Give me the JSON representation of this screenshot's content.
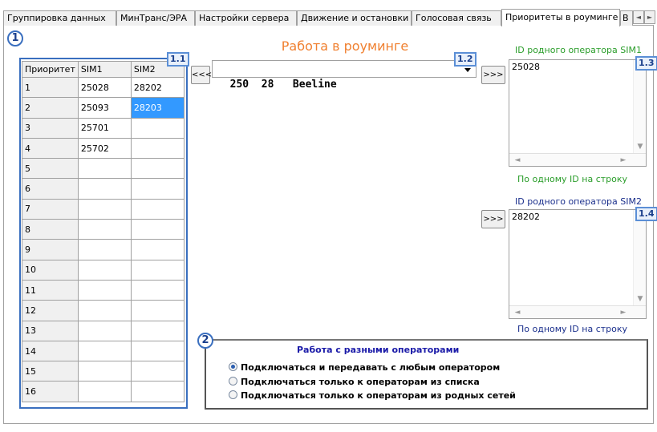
{
  "tabs": [
    {
      "label": "Группировка данных"
    },
    {
      "label": "МинТранс/ЭРА"
    },
    {
      "label": "Настройки сервера"
    },
    {
      "label": "Движение и остановки"
    },
    {
      "label": "Голосовая связь"
    },
    {
      "label": "Приоритеты в роуминге",
      "active": true
    },
    {
      "label": "В"
    }
  ],
  "badges": {
    "b1": "1",
    "b11": "1.1",
    "b12": "1.2",
    "b13": "1.3",
    "b14": "1.4",
    "b2": "2"
  },
  "roaming": {
    "title": "Работа в роуминге",
    "move_left_label": "<<<",
    "move_right1_label": ">>>",
    "move_right2_label": ">>>",
    "operator_select": "250  28   Beeline"
  },
  "priority_table": {
    "headers": [
      "Приоритет",
      "SIM1",
      "SIM2"
    ],
    "rows": [
      [
        "1",
        "25028",
        "28202"
      ],
      [
        "2",
        "25093",
        "28203"
      ],
      [
        "3",
        "25701",
        ""
      ],
      [
        "4",
        "25702",
        ""
      ],
      [
        "5",
        "",
        ""
      ],
      [
        "6",
        "",
        ""
      ],
      [
        "7",
        "",
        ""
      ],
      [
        "8",
        "",
        ""
      ],
      [
        "9",
        "",
        ""
      ],
      [
        "10",
        "",
        ""
      ],
      [
        "11",
        "",
        ""
      ],
      [
        "12",
        "",
        ""
      ],
      [
        "13",
        "",
        ""
      ],
      [
        "14",
        "",
        ""
      ],
      [
        "15",
        "",
        ""
      ],
      [
        "16",
        "",
        ""
      ]
    ],
    "selected_row": 2,
    "selected_col": "SIM2"
  },
  "sim1_home": {
    "label": "ID родного оператора SIM1",
    "values": [
      "25028"
    ],
    "hint": "По одному ID на строку"
  },
  "sim2_home": {
    "label": "ID родного оператора SIM2",
    "values": [
      "28202"
    ],
    "hint": "По одному ID на строку"
  },
  "operators_group": {
    "title": "Работа с разными операторами",
    "options": [
      {
        "label": "Подключаться и передавать с любым оператором",
        "selected": true
      },
      {
        "label": "Подключаться только к операторам из списка",
        "selected": false
      },
      {
        "label": "Подключаться только к операторам из родных сетей",
        "selected": false
      }
    ]
  },
  "colors": {
    "accent": "#3a6fbf",
    "title_orange": "#f08030",
    "label_green": "#2a9d2a",
    "selection": "#3399ff"
  }
}
